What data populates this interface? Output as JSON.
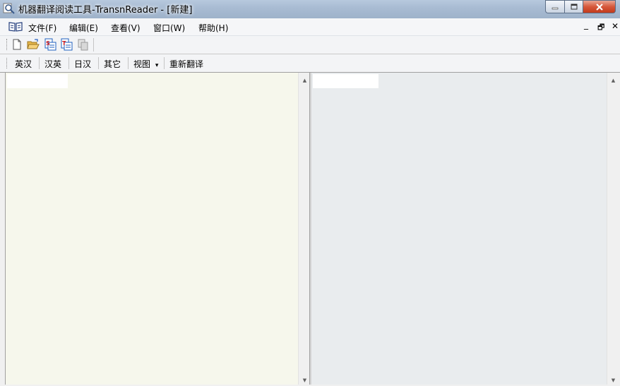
{
  "window": {
    "title": "机器翻译阅读工具-TransnReader - [新建]"
  },
  "menu": {
    "items": [
      {
        "label": "文件(F)"
      },
      {
        "label": "编辑(E)"
      },
      {
        "label": "查看(V)"
      },
      {
        "label": "窗口(W)"
      },
      {
        "label": "帮助(H)"
      }
    ],
    "mdi_minimize": "_",
    "mdi_restore": "🗗",
    "mdi_close": "✕"
  },
  "toolbar": {
    "icons": [
      "new-document-icon",
      "open-folder-icon",
      "translate-source-icon",
      "translate-target-icon",
      "copy-disabled-icon"
    ]
  },
  "language_bar": {
    "buttons": [
      {
        "label": "英汉"
      },
      {
        "label": "汉英"
      },
      {
        "label": "日汉"
      },
      {
        "label": "其它"
      }
    ],
    "view_label": "视图",
    "view_arrow": "▾",
    "retranslate_label": "重新翻译"
  },
  "scroll": {
    "up": "▲",
    "down": "▼"
  },
  "colors": {
    "source_pane": "#f6f7ec",
    "target_pane": "#e9ecee",
    "close_button": "#c8401f"
  }
}
